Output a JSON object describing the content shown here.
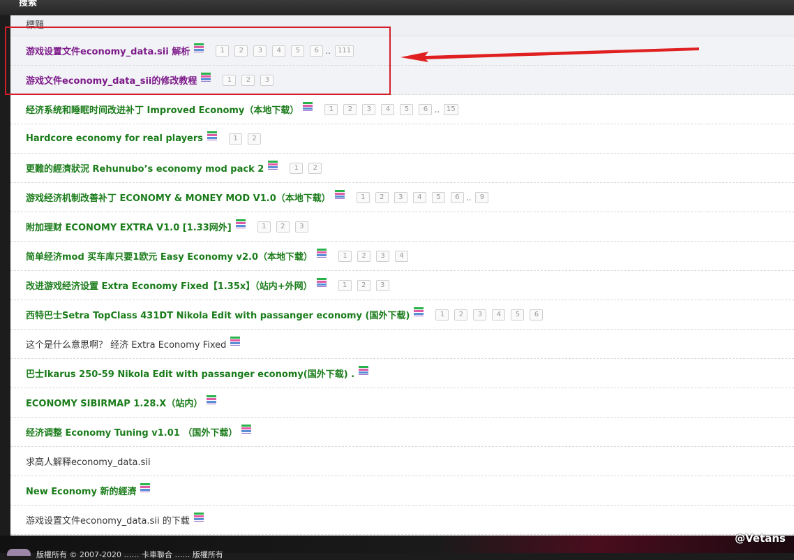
{
  "header": {
    "title": "搜索"
  },
  "table": {
    "column_title": "標題"
  },
  "rows": [
    {
      "title": "游戏设置文件economy_data.sii 解析",
      "style": "purple",
      "pages": [
        "1",
        "2",
        "3",
        "4",
        "5",
        "6"
      ],
      "last_page": "111"
    },
    {
      "title": "游戏文件economy_data_sii的修改教程",
      "style": "purple",
      "pages": [
        "1",
        "2",
        "3"
      ]
    },
    {
      "title": "经济系统和睡眠时间改进补丁 Improved Economy（本地下载）",
      "style": "green",
      "pages": [
        "1",
        "2",
        "3",
        "4",
        "5",
        "6"
      ],
      "last_page": "15"
    },
    {
      "title": "Hardcore economy for real players",
      "style": "green",
      "pages": [
        "1",
        "2"
      ]
    },
    {
      "title": "更難的經濟狀況 Rehunubo’s economy mod pack 2",
      "style": "green",
      "pages": [
        "1",
        "2"
      ]
    },
    {
      "title": "游戏经济机制改善补丁 ECONOMY & MONEY MOD V1.0（本地下载）",
      "style": "green",
      "pages": [
        "1",
        "2",
        "3",
        "4",
        "5",
        "6"
      ],
      "last_page": "9"
    },
    {
      "title": "附加理财 ECONOMY EXTRA V1.0 [1.33网外]",
      "style": "green",
      "pages": [
        "1",
        "2",
        "3"
      ]
    },
    {
      "title": "简单经济mod 买车库只要1欧元 Easy Economy v2.0（本地下载）",
      "style": "green",
      "pages": [
        "1",
        "2",
        "3",
        "4"
      ]
    },
    {
      "title": "改进游戏经济设置 Extra Economy Fixed【1.35x】（站内+外网）",
      "style": "green",
      "pages": [
        "1",
        "2",
        "3"
      ]
    },
    {
      "title": "西特巴士Setra TopClass 431DT Nikola Edit with passanger economy (国外下载)",
      "style": "green",
      "pages": [
        "1",
        "2",
        "3",
        "4",
        "5",
        "6"
      ]
    },
    {
      "title": "这个是什么意思啊？ 经济 Extra Economy Fixed",
      "style": "plain",
      "pages": []
    },
    {
      "title": "巴士Ikarus 250-59 Nikola Edit with passanger economy(国外下载) .",
      "style": "green",
      "pages": []
    },
    {
      "title": "ECONOMY SIBIRMAP 1.28.X（站内）",
      "style": "green",
      "pages": []
    },
    {
      "title": "经济调整 Economy Tuning v1.01 （国外下载）",
      "style": "green",
      "pages": []
    },
    {
      "title": "求高人解释economy_data.sii",
      "style": "plain",
      "pages": [],
      "no_icon": true
    },
    {
      "title": "New Economy 新的經濟",
      "style": "green",
      "pages": []
    },
    {
      "title": "游戏设置文件economy_data.sii 的下载",
      "style": "plain",
      "pages": []
    }
  ],
  "footer": {
    "text": "版權所有 © 2007-2020 …… 卡車聯合 …… 版權所有"
  },
  "watermark": "@Vetans",
  "colors": {
    "green_link": "#1a7c1a",
    "purple_link": "#7d1a8a",
    "highlight_box": "#d21e2b",
    "arrow": "#e02020"
  },
  "icons": {
    "attachment": "attachment-stack-icon",
    "arrow": "red-arrow-annotation"
  }
}
